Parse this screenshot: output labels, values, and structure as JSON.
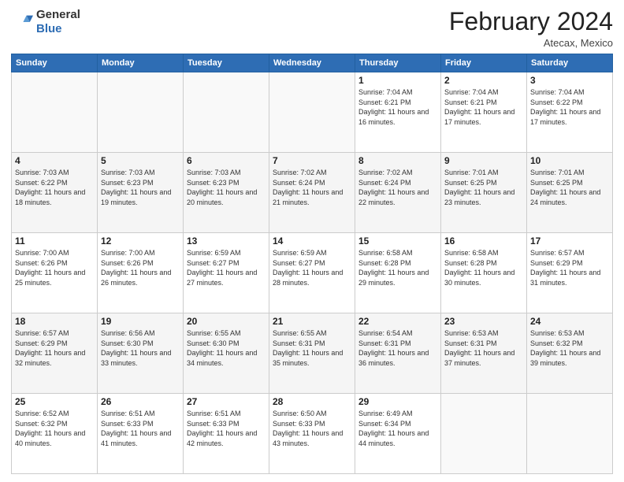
{
  "header": {
    "logo_general": "General",
    "logo_blue": "Blue",
    "month_title": "February 2024",
    "subtitle": "Atecax, Mexico"
  },
  "days_of_week": [
    "Sunday",
    "Monday",
    "Tuesday",
    "Wednesday",
    "Thursday",
    "Friday",
    "Saturday"
  ],
  "weeks": [
    [
      {
        "day": "",
        "info": ""
      },
      {
        "day": "",
        "info": ""
      },
      {
        "day": "",
        "info": ""
      },
      {
        "day": "",
        "info": ""
      },
      {
        "day": "1",
        "info": "Sunrise: 7:04 AM\nSunset: 6:21 PM\nDaylight: 11 hours and 16 minutes."
      },
      {
        "day": "2",
        "info": "Sunrise: 7:04 AM\nSunset: 6:21 PM\nDaylight: 11 hours and 17 minutes."
      },
      {
        "day": "3",
        "info": "Sunrise: 7:04 AM\nSunset: 6:22 PM\nDaylight: 11 hours and 17 minutes."
      }
    ],
    [
      {
        "day": "4",
        "info": "Sunrise: 7:03 AM\nSunset: 6:22 PM\nDaylight: 11 hours and 18 minutes."
      },
      {
        "day": "5",
        "info": "Sunrise: 7:03 AM\nSunset: 6:23 PM\nDaylight: 11 hours and 19 minutes."
      },
      {
        "day": "6",
        "info": "Sunrise: 7:03 AM\nSunset: 6:23 PM\nDaylight: 11 hours and 20 minutes."
      },
      {
        "day": "7",
        "info": "Sunrise: 7:02 AM\nSunset: 6:24 PM\nDaylight: 11 hours and 21 minutes."
      },
      {
        "day": "8",
        "info": "Sunrise: 7:02 AM\nSunset: 6:24 PM\nDaylight: 11 hours and 22 minutes."
      },
      {
        "day": "9",
        "info": "Sunrise: 7:01 AM\nSunset: 6:25 PM\nDaylight: 11 hours and 23 minutes."
      },
      {
        "day": "10",
        "info": "Sunrise: 7:01 AM\nSunset: 6:25 PM\nDaylight: 11 hours and 24 minutes."
      }
    ],
    [
      {
        "day": "11",
        "info": "Sunrise: 7:00 AM\nSunset: 6:26 PM\nDaylight: 11 hours and 25 minutes."
      },
      {
        "day": "12",
        "info": "Sunrise: 7:00 AM\nSunset: 6:26 PM\nDaylight: 11 hours and 26 minutes."
      },
      {
        "day": "13",
        "info": "Sunrise: 6:59 AM\nSunset: 6:27 PM\nDaylight: 11 hours and 27 minutes."
      },
      {
        "day": "14",
        "info": "Sunrise: 6:59 AM\nSunset: 6:27 PM\nDaylight: 11 hours and 28 minutes."
      },
      {
        "day": "15",
        "info": "Sunrise: 6:58 AM\nSunset: 6:28 PM\nDaylight: 11 hours and 29 minutes."
      },
      {
        "day": "16",
        "info": "Sunrise: 6:58 AM\nSunset: 6:28 PM\nDaylight: 11 hours and 30 minutes."
      },
      {
        "day": "17",
        "info": "Sunrise: 6:57 AM\nSunset: 6:29 PM\nDaylight: 11 hours and 31 minutes."
      }
    ],
    [
      {
        "day": "18",
        "info": "Sunrise: 6:57 AM\nSunset: 6:29 PM\nDaylight: 11 hours and 32 minutes."
      },
      {
        "day": "19",
        "info": "Sunrise: 6:56 AM\nSunset: 6:30 PM\nDaylight: 11 hours and 33 minutes."
      },
      {
        "day": "20",
        "info": "Sunrise: 6:55 AM\nSunset: 6:30 PM\nDaylight: 11 hours and 34 minutes."
      },
      {
        "day": "21",
        "info": "Sunrise: 6:55 AM\nSunset: 6:31 PM\nDaylight: 11 hours and 35 minutes."
      },
      {
        "day": "22",
        "info": "Sunrise: 6:54 AM\nSunset: 6:31 PM\nDaylight: 11 hours and 36 minutes."
      },
      {
        "day": "23",
        "info": "Sunrise: 6:53 AM\nSunset: 6:31 PM\nDaylight: 11 hours and 37 minutes."
      },
      {
        "day": "24",
        "info": "Sunrise: 6:53 AM\nSunset: 6:32 PM\nDaylight: 11 hours and 39 minutes."
      }
    ],
    [
      {
        "day": "25",
        "info": "Sunrise: 6:52 AM\nSunset: 6:32 PM\nDaylight: 11 hours and 40 minutes."
      },
      {
        "day": "26",
        "info": "Sunrise: 6:51 AM\nSunset: 6:33 PM\nDaylight: 11 hours and 41 minutes."
      },
      {
        "day": "27",
        "info": "Sunrise: 6:51 AM\nSunset: 6:33 PM\nDaylight: 11 hours and 42 minutes."
      },
      {
        "day": "28",
        "info": "Sunrise: 6:50 AM\nSunset: 6:33 PM\nDaylight: 11 hours and 43 minutes."
      },
      {
        "day": "29",
        "info": "Sunrise: 6:49 AM\nSunset: 6:34 PM\nDaylight: 11 hours and 44 minutes."
      },
      {
        "day": "",
        "info": ""
      },
      {
        "day": "",
        "info": ""
      }
    ]
  ]
}
